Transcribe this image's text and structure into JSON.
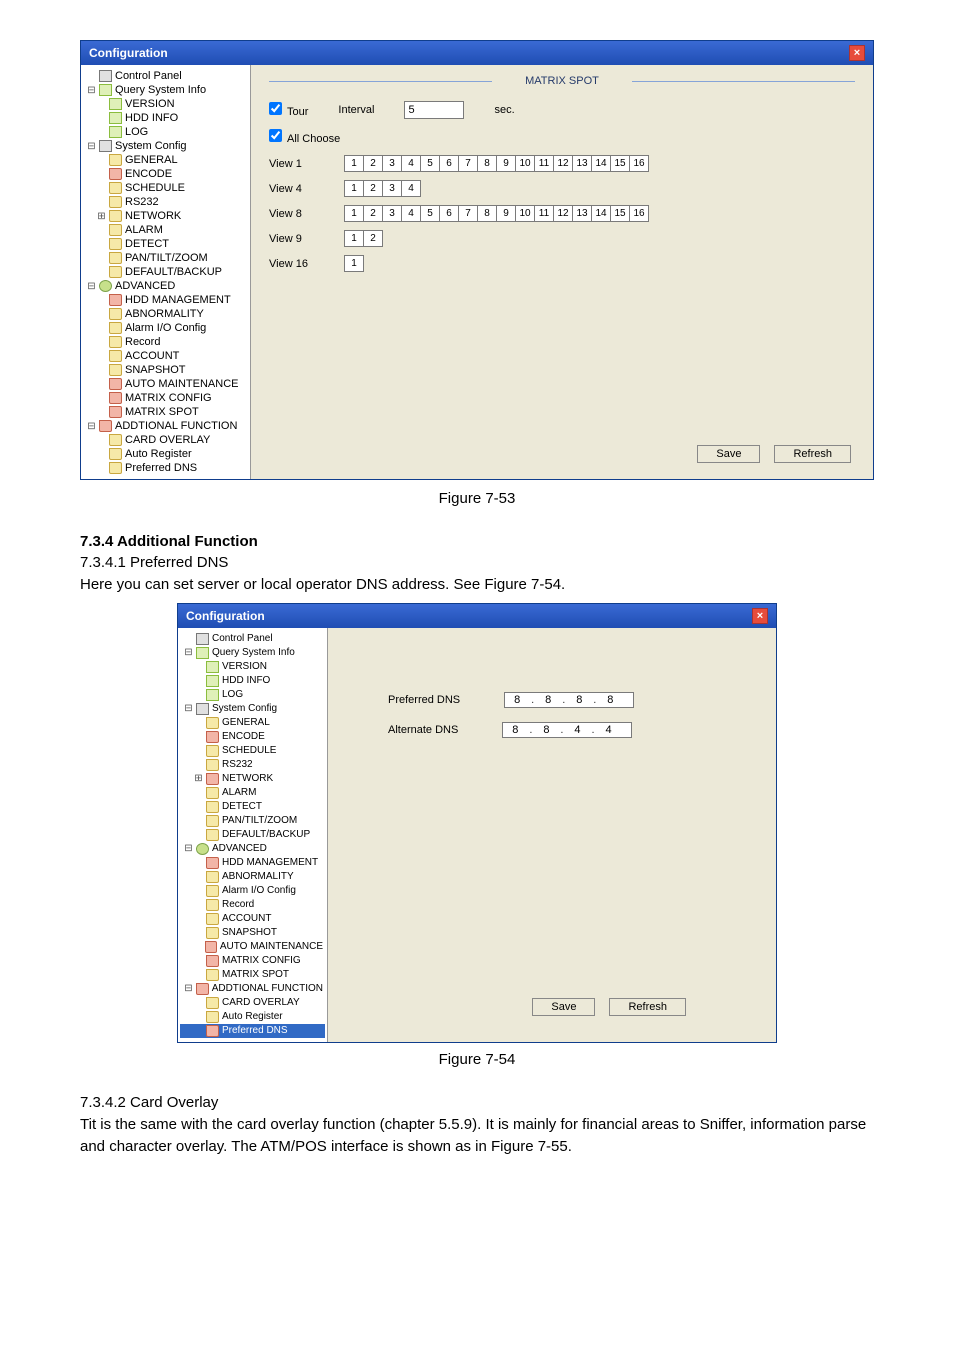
{
  "window1": {
    "title": "Configuration",
    "section_title": "MATRIX SPOT",
    "tour_label": "Tour",
    "interval_label": "Interval",
    "interval_value": "5",
    "sec_label": "sec.",
    "allchoose_label": "All Choose",
    "views": [
      {
        "label": "View 1",
        "boxes": [
          "1",
          "2",
          "3",
          "4",
          "5",
          "6",
          "7",
          "8",
          "9",
          "10",
          "11",
          "12",
          "13",
          "14",
          "15",
          "16"
        ]
      },
      {
        "label": "View 4",
        "boxes": [
          "1",
          "2",
          "3",
          "4"
        ]
      },
      {
        "label": "View 8",
        "boxes": [
          "1",
          "2",
          "3",
          "4",
          "5",
          "6",
          "7",
          "8",
          "9",
          "10",
          "11",
          "12",
          "13",
          "14",
          "15",
          "16"
        ]
      },
      {
        "label": "View 9",
        "boxes": [
          "1",
          "2"
        ]
      },
      {
        "label": "View 16",
        "boxes": [
          "1"
        ]
      }
    ],
    "save": "Save",
    "refresh": "Refresh",
    "tree": [
      {
        "label": "Control Panel",
        "icon": "panel",
        "indent": 0
      },
      {
        "label": "Query System Info",
        "icon": "doc",
        "indent": 0,
        "exp": "⊟"
      },
      {
        "label": "VERSION",
        "icon": "doc",
        "indent": 1
      },
      {
        "label": "HDD INFO",
        "icon": "doc",
        "indent": 1
      },
      {
        "label": "LOG",
        "icon": "doc",
        "indent": 1
      },
      {
        "label": "System Config",
        "icon": "panel",
        "indent": 0,
        "exp": "⊟"
      },
      {
        "label": "GENERAL",
        "icon": "folder",
        "indent": 1
      },
      {
        "label": "ENCODE",
        "icon": "folder-red",
        "indent": 1
      },
      {
        "label": "SCHEDULE",
        "icon": "folder",
        "indent": 1
      },
      {
        "label": "RS232",
        "icon": "folder",
        "indent": 1
      },
      {
        "label": "NETWORK",
        "icon": "folder",
        "indent": 1,
        "exp": "⊞"
      },
      {
        "label": "ALARM",
        "icon": "folder",
        "indent": 1
      },
      {
        "label": "DETECT",
        "icon": "folder",
        "indent": 1
      },
      {
        "label": "PAN/TILT/ZOOM",
        "icon": "folder",
        "indent": 1
      },
      {
        "label": "DEFAULT/BACKUP",
        "icon": "folder",
        "indent": 1
      },
      {
        "label": "ADVANCED",
        "icon": "adv",
        "indent": 0,
        "exp": "⊟"
      },
      {
        "label": "HDD MANAGEMENT",
        "icon": "folder-red",
        "indent": 1
      },
      {
        "label": "ABNORMALITY",
        "icon": "folder",
        "indent": 1
      },
      {
        "label": "Alarm I/O Config",
        "icon": "folder",
        "indent": 1
      },
      {
        "label": "Record",
        "icon": "folder",
        "indent": 1
      },
      {
        "label": "ACCOUNT",
        "icon": "folder",
        "indent": 1
      },
      {
        "label": "SNAPSHOT",
        "icon": "folder",
        "indent": 1
      },
      {
        "label": "AUTO MAINTENANCE",
        "icon": "folder-red",
        "indent": 1
      },
      {
        "label": "MATRIX CONFIG",
        "icon": "folder-red",
        "indent": 1
      },
      {
        "label": "MATRIX SPOT",
        "icon": "folder-red",
        "indent": 1
      },
      {
        "label": "ADDTIONAL FUNCTION",
        "icon": "folder-red",
        "indent": 0,
        "exp": "⊟"
      },
      {
        "label": "CARD OVERLAY",
        "icon": "folder",
        "indent": 1
      },
      {
        "label": "Auto Register",
        "icon": "folder",
        "indent": 1
      },
      {
        "label": "Preferred DNS",
        "icon": "folder",
        "indent": 1
      }
    ]
  },
  "caption1": "Figure 7-53",
  "section": {
    "h3": "7.3.4  Additional Function",
    "sub1": "7.3.4.1  Preferred DNS",
    "p1": "Here you can set server or local operator DNS address. See Figure 7-54."
  },
  "window2": {
    "title": "Configuration",
    "preferred_label": "Preferred DNS",
    "alternate_label": "Alternate DNS",
    "preferred_ip": [
      "8",
      "8",
      "8",
      "8"
    ],
    "alternate_ip": [
      "8",
      "8",
      "4",
      "4"
    ],
    "save": "Save",
    "refresh": "Refresh",
    "tree": [
      {
        "label": "Control Panel",
        "icon": "panel",
        "indent": 0
      },
      {
        "label": "Query System Info",
        "icon": "doc",
        "indent": 0,
        "exp": "⊟"
      },
      {
        "label": "VERSION",
        "icon": "doc",
        "indent": 1
      },
      {
        "label": "HDD INFO",
        "icon": "doc",
        "indent": 1
      },
      {
        "label": "LOG",
        "icon": "doc",
        "indent": 1
      },
      {
        "label": "System Config",
        "icon": "panel",
        "indent": 0,
        "exp": "⊟"
      },
      {
        "label": "GENERAL",
        "icon": "folder",
        "indent": 1
      },
      {
        "label": "ENCODE",
        "icon": "folder-red",
        "indent": 1
      },
      {
        "label": "SCHEDULE",
        "icon": "folder",
        "indent": 1
      },
      {
        "label": "RS232",
        "icon": "folder",
        "indent": 1
      },
      {
        "label": "NETWORK",
        "icon": "folder-red",
        "indent": 1,
        "exp": "⊞"
      },
      {
        "label": "ALARM",
        "icon": "folder",
        "indent": 1
      },
      {
        "label": "DETECT",
        "icon": "folder",
        "indent": 1
      },
      {
        "label": "PAN/TILT/ZOOM",
        "icon": "folder",
        "indent": 1
      },
      {
        "label": "DEFAULT/BACKUP",
        "icon": "folder",
        "indent": 1
      },
      {
        "label": "ADVANCED",
        "icon": "adv",
        "indent": 0,
        "exp": "⊟"
      },
      {
        "label": "HDD MANAGEMENT",
        "icon": "folder-red",
        "indent": 1
      },
      {
        "label": "ABNORMALITY",
        "icon": "folder",
        "indent": 1
      },
      {
        "label": "Alarm I/O Config",
        "icon": "folder",
        "indent": 1
      },
      {
        "label": "Record",
        "icon": "folder",
        "indent": 1
      },
      {
        "label": "ACCOUNT",
        "icon": "folder",
        "indent": 1
      },
      {
        "label": "SNAPSHOT",
        "icon": "folder",
        "indent": 1
      },
      {
        "label": "AUTO MAINTENANCE",
        "icon": "folder-red",
        "indent": 1
      },
      {
        "label": "MATRIX CONFIG",
        "icon": "folder-red",
        "indent": 1
      },
      {
        "label": "MATRIX SPOT",
        "icon": "folder",
        "indent": 1
      },
      {
        "label": "ADDTIONAL FUNCTION",
        "icon": "folder-red",
        "indent": 0,
        "exp": "⊟"
      },
      {
        "label": "CARD OVERLAY",
        "icon": "folder",
        "indent": 1
      },
      {
        "label": "Auto Register",
        "icon": "folder",
        "indent": 1
      },
      {
        "label": "Preferred DNS",
        "icon": "folder-red",
        "indent": 1,
        "selected": true
      }
    ]
  },
  "caption2": "Figure 7-54",
  "section2": {
    "sub": "7.3.4.2  Card Overlay",
    "p": "Tit is the same with the card overlay function (chapter 5.5.9). It is mainly for financial areas to Sniffer, information parse and character overlay. The ATM/POS interface is shown as in Figure 7-55."
  }
}
